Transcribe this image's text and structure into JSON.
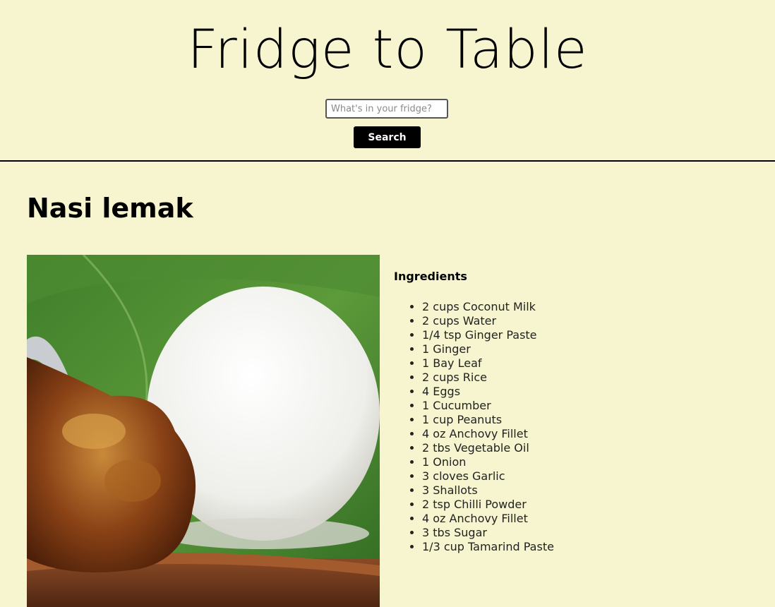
{
  "header": {
    "site_title": "Fridge to Table",
    "search_placeholder": "What's in your fridge?",
    "search_value": "",
    "search_button_label": "Search"
  },
  "recipe": {
    "title": "Nasi lemak",
    "ingredients_heading": "Ingredients",
    "ingredients": [
      "2 cups Coconut Milk",
      "2 cups Water",
      "1/4 tsp Ginger Paste",
      "1 Ginger",
      "1 Bay Leaf",
      "2 cups Rice",
      "4 Eggs",
      "1 Cucumber",
      "1 cup Peanuts",
      "4 oz Anchovy Fillet",
      "2 tbs Vegetable Oil",
      "1 Onion",
      "3 cloves Garlic",
      "3 Shallots",
      "2 tsp Chilli Powder",
      "4 oz Anchovy Fillet",
      "3 tbs Sugar",
      "1/3 cup Tamarind Paste"
    ]
  },
  "colors": {
    "background": "#f6f5d0",
    "button": "#000000",
    "button_text": "#ffffff"
  }
}
